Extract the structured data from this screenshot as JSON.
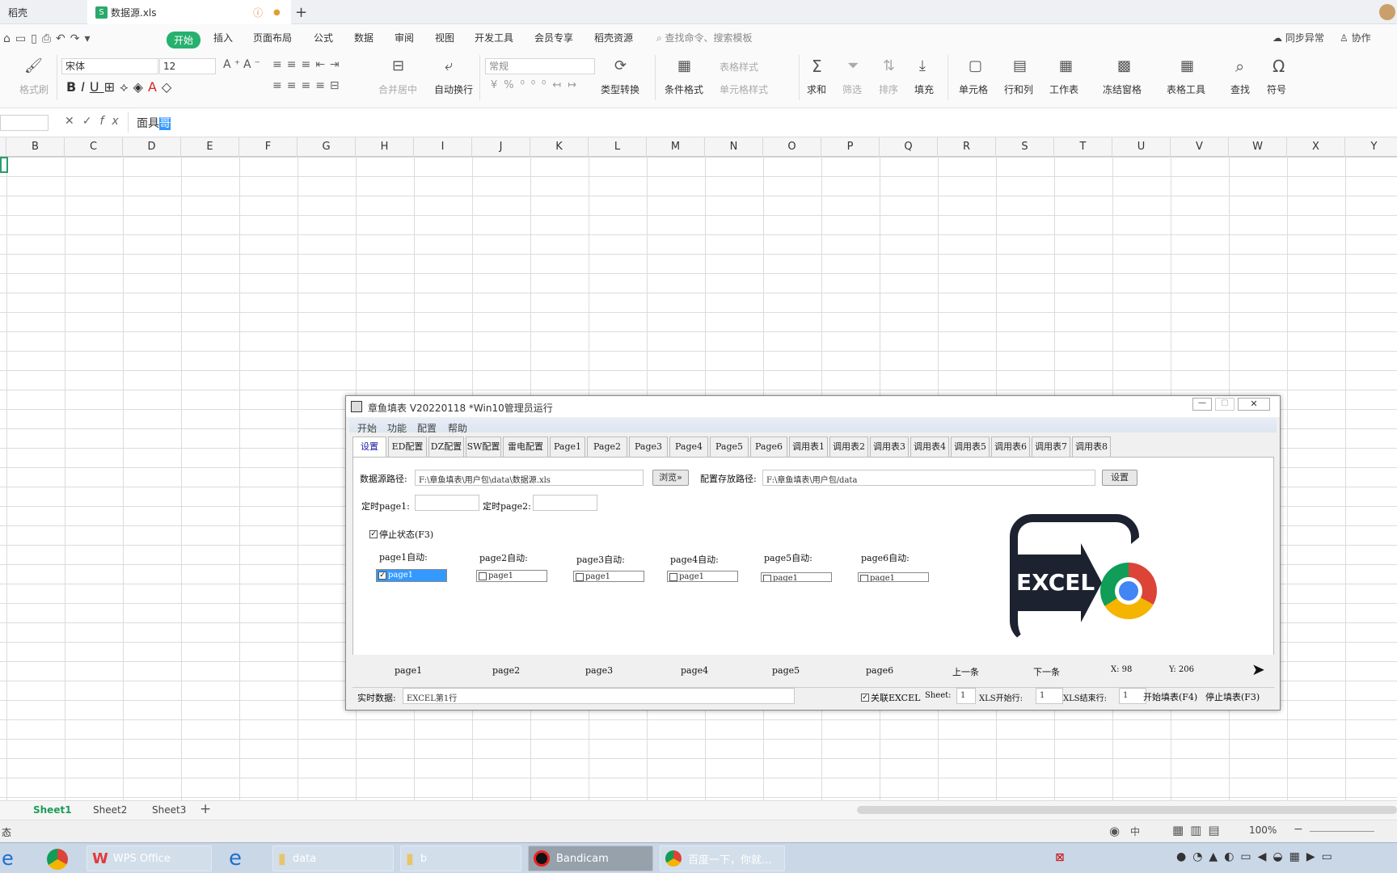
{
  "tabs": {
    "home": "稻壳",
    "file": "数据源.xls"
  },
  "menu": {
    "start": "开始",
    "insert": "插入",
    "layout": "页面布局",
    "formula": "公式",
    "data": "数据",
    "review": "审阅",
    "view": "视图",
    "dev": "开发工具",
    "member": "会员专享",
    "docer": "稻壳资源",
    "search": "查找命令、搜索模板",
    "sync": "同步异常",
    "collab": "协作"
  },
  "ribbon": {
    "format_painter": "格式刷",
    "font": "宋体",
    "size": "12",
    "merge": "合并居中",
    "wrap": "自动换行",
    "numfmt": "常规",
    "typeconv": "类型转换",
    "condfmt": "条件格式",
    "tablestyle": "表格样式",
    "cellstyle": "单元格样式",
    "sum": "求和",
    "filter": "筛选",
    "sort": "排序",
    "fill": "填充",
    "cell": "单元格",
    "rowcol": "行和列",
    "sheet": "工作表",
    "freeze": "冻结窗格",
    "tabletools": "表格工具",
    "find": "查找",
    "symbol": "符号"
  },
  "formula": {
    "value": "面具哥",
    "selected": "哥"
  },
  "columns": [
    "B",
    "C",
    "D",
    "E",
    "F",
    "G",
    "H",
    "I",
    "J",
    "K",
    "L",
    "M",
    "N",
    "O",
    "P",
    "Q",
    "R",
    "S",
    "T",
    "U",
    "V",
    "W",
    "X",
    "Y"
  ],
  "sheets": [
    "Sheet1",
    "Sheet2",
    "Sheet3"
  ],
  "status": {
    "left": "态",
    "zoom": "100%",
    "lang": "中"
  },
  "taskbar": {
    "wps": "WPS Office",
    "data": "data",
    "b": "b",
    "bandicam": "Bandicam",
    "baidu": "百度一下，你就..."
  },
  "dialog": {
    "title": "章鱼填表 V20220118 *Win10管理员运行",
    "menus": [
      "开始",
      "功能",
      "配置",
      "帮助"
    ],
    "tabs": [
      "设置",
      "ED配置",
      "DZ配置",
      "SW配置",
      "雷电配置",
      "Page1",
      "Page2",
      "Page3",
      "Page4",
      "Page5",
      "Page6",
      "调用表1",
      "调用表2",
      "调用表3",
      "调用表4",
      "调用表5",
      "调用表6",
      "调用表7",
      "调用表8"
    ],
    "src_label": "数据源路径:",
    "src_value": "F:\\章鱼填表\\用户包\\data\\数据源.xls",
    "browse": "浏览»",
    "cfg_label": "配置存放路径:",
    "cfg_value": "F:\\章鱼填表\\用户包/data",
    "set": "设置",
    "timer1": "定时page1:",
    "timer2": "定时page2:",
    "stop": "停止状态(F3)",
    "auto_labels": [
      "page1自动:",
      "page2自动:",
      "page3自动:",
      "page4自动:",
      "page5自动:",
      "page6自动:"
    ],
    "list_items": [
      "page1",
      "page2",
      "page3",
      "page4",
      "page5",
      "page6"
    ],
    "nav": [
      "page1",
      "page2",
      "page3",
      "page4",
      "page5",
      "page6",
      "上一条",
      "下一条"
    ],
    "x": "X: 98",
    "y": "Y: 206",
    "realtime": "实时数据:",
    "realtime_value": "EXCEL第1行",
    "link": "关联EXCEL",
    "sheet_label": "Sheet:",
    "sheet_value": "1",
    "start_label": "XLS开始行:",
    "start_value": "1",
    "end_label": "XLS结束行:",
    "end_value": "1",
    "start_fill": "开始填表(F4)",
    "stop_fill": "停止填表(F3)",
    "logo_text": "EXCEL"
  }
}
